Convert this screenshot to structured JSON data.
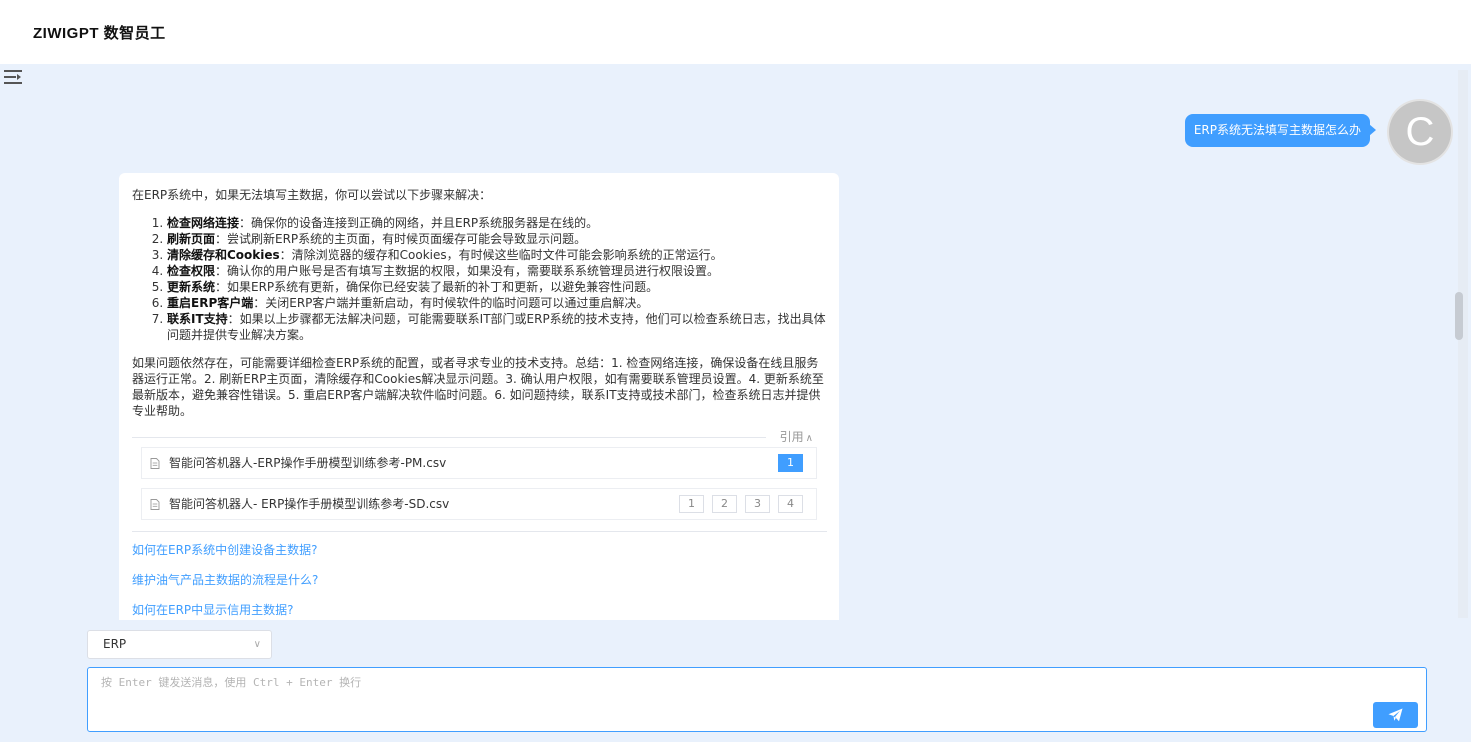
{
  "header": {
    "brand": "ZIWIGPT 数智员工"
  },
  "user_message": {
    "text": "ERP系统无法填写主数据怎么办",
    "avatar_letter": "C"
  },
  "bot_reply": {
    "intro": "在ERP系统中，如果无法填写主数据，你可以尝试以下步骤来解决：",
    "steps": [
      {
        "title": "检查网络连接",
        "text": "：确保你的设备连接到正确的网络，并且ERP系统服务器是在线的。"
      },
      {
        "title": "刷新页面",
        "text": "：尝试刷新ERP系统的主页面，有时候页面缓存可能会导致显示问题。"
      },
      {
        "title": "清除缓存和Cookies",
        "text": "：清除浏览器的缓存和Cookies，有时候这些临时文件可能会影响系统的正常运行。"
      },
      {
        "title": "检查权限",
        "text": "：确认你的用户账号是否有填写主数据的权限，如果没有，需要联系系统管理员进行权限设置。"
      },
      {
        "title": "更新系统",
        "text": "：如果ERP系统有更新，确保你已经安装了最新的补丁和更新，以避免兼容性问题。"
      },
      {
        "title": "重启ERP客户端",
        "text": "：关闭ERP客户端并重新启动，有时候软件的临时问题可以通过重启解决。"
      },
      {
        "title": "联系IT支持",
        "text": "：如果以上步骤都无法解决问题，可能需要联系IT部门或ERP系统的技术支持，他们可以检查系统日志，找出具体问题并提供专业解决方案。"
      }
    ],
    "summary": "如果问题依然存在，可能需要详细检查ERP系统的配置，或者寻求专业的技术支持。总结：1. 检查网络连接，确保设备在线且服务器运行正常。2. 刷新ERP主页面，清除缓存和Cookies解决显示问题。3. 确认用户权限，如有需要联系管理员设置。4. 更新系统至最新版本，避免兼容性错误。5. 重启ERP客户端解决软件临时问题。6. 如问题持续，联系IT支持或技术部门，检查系统日志并提供专业帮助。",
    "citations_label": "引用",
    "citations": [
      {
        "name": "智能问答机器人-ERP操作手册模型训练参考-PM.csv",
        "pages": [
          "1"
        ],
        "active_page": "1"
      },
      {
        "name": "智能问答机器人- ERP操作手册模型训练参考-SD.csv",
        "pages": [
          "1",
          "2",
          "3",
          "4"
        ],
        "active_page": ""
      }
    ],
    "suggestions": [
      "如何在ERP系统中创建设备主数据?",
      "维护油气产品主数据的流程是什么?",
      "如何在ERP中显示信用主数据?"
    ]
  },
  "composer": {
    "selected_model": "ERP",
    "placeholder": "按 Enter 键发送消息，使用 Ctrl + Enter 换行"
  },
  "colors": {
    "accent": "#409eff",
    "background": "#e9f1fc"
  }
}
